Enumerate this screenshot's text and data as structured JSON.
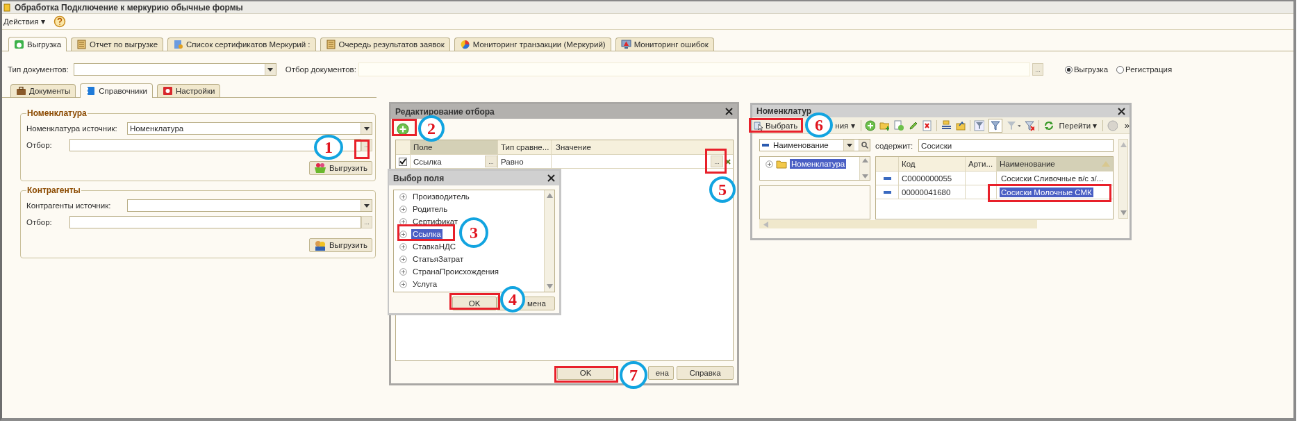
{
  "window": {
    "title": "Обработка  Подключение к меркурию обычные формы"
  },
  "toolbar": {
    "actions_menu": "Действия ▾"
  },
  "tabs": [
    {
      "label": "Выгрузка",
      "selected": true
    },
    {
      "label": "Отчет по выгрузке",
      "selected": false
    },
    {
      "label": "Список сертификатов Меркурий :",
      "selected": false
    },
    {
      "label": "Очередь результатов заявок",
      "selected": false
    },
    {
      "label": "Мониторинг транзакции (Меркурий)",
      "selected": false
    },
    {
      "label": "Мониторинг ошибок",
      "selected": false
    }
  ],
  "document_filter": {
    "type_label": "Тип документов:",
    "filter_label": "Отбор документов:",
    "filter_button": "...",
    "modes": [
      {
        "label": "Выгрузка",
        "selected": true
      },
      {
        "label": "Регистрация",
        "selected": false
      }
    ]
  },
  "subtabs": [
    {
      "label": "Документы",
      "selected": false
    },
    {
      "label": "Справочники",
      "selected": true
    },
    {
      "label": "Настройки",
      "selected": false
    }
  ],
  "groups": [
    {
      "title": "Номенклатура",
      "source_label": "Номенклатура источник:",
      "source_value": "Номенклатура",
      "filter_label": "Отбор:",
      "filter_button": "...",
      "button": "Выгрузить"
    },
    {
      "title": "Контрагенты",
      "source_label": "Контрагенты источник:",
      "filter_label": "Отбор:",
      "filter_button": "...",
      "button": "Выгрузить"
    }
  ],
  "filter_dialog": {
    "title": "Редактирование отбора",
    "columns": [
      "Поле",
      "Тип сравне...",
      "Значение"
    ],
    "rows": [
      {
        "checked": true,
        "field": "Ссылка",
        "field_button": "...",
        "comparison": "Равно",
        "value_button": "..."
      }
    ],
    "buttons": [
      "OK",
      "ена",
      "Справка"
    ]
  },
  "field_dialog": {
    "title": "Выбор поля",
    "items": [
      {
        "label": "Производитель",
        "selected": false
      },
      {
        "label": "Родитель",
        "selected": false
      },
      {
        "label": "Сертификат",
        "selected": false
      },
      {
        "label": "Ссылка",
        "selected": true
      },
      {
        "label": "СтавкаНДС",
        "selected": false
      },
      {
        "label": "СтатьяЗатрат",
        "selected": false
      },
      {
        "label": "СтранаПроисхождения",
        "selected": false
      },
      {
        "label": "Услуга",
        "selected": false
      }
    ],
    "buttons": [
      "OK",
      "мена"
    ]
  },
  "catalog_window": {
    "title": "Номенклатур",
    "select_button": "Выбрать",
    "actions_menu": "ния ▾",
    "goto_menu": "Перейти ▾",
    "more": "»",
    "search": {
      "field": "Наименование",
      "contains_label": "содержит:",
      "value": "Сосиски"
    },
    "tree": [
      {
        "label": "Номенклатура",
        "selected": true
      }
    ],
    "columns": [
      "Код",
      "Арти...",
      "Наименование"
    ],
    "rows": [
      {
        "code": "C0000000055",
        "name": "Сосиски  Сливочные  в/с  з/...",
        "selected": false
      },
      {
        "code": "00000041680",
        "name": "Сосиски Молочные СМК",
        "selected": true
      }
    ]
  },
  "annotations": [
    {
      "number": "1"
    },
    {
      "number": "2"
    },
    {
      "number": "3"
    },
    {
      "number": "4"
    },
    {
      "number": "5"
    },
    {
      "number": "6"
    },
    {
      "number": "7"
    }
  ]
}
